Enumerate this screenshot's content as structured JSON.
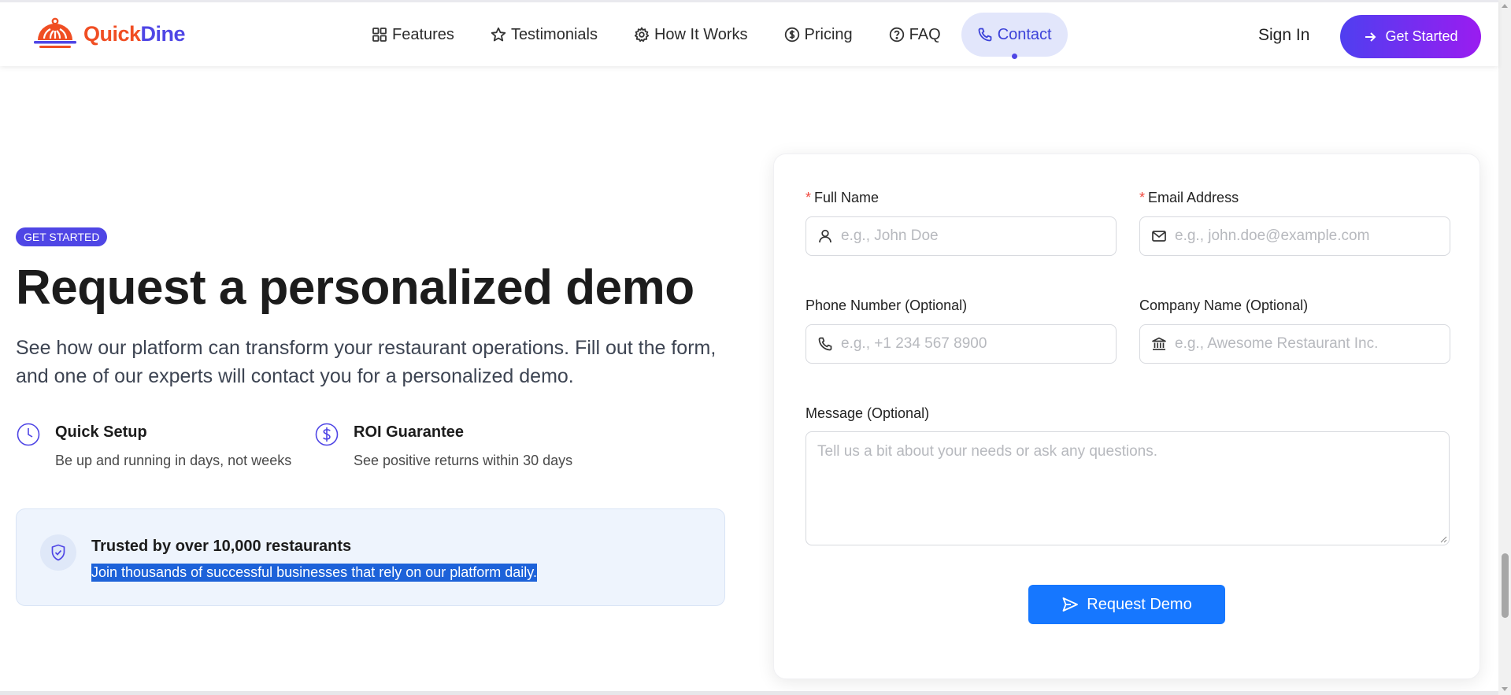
{
  "brand": {
    "name_part1": "Quick",
    "name_part2": "Dine"
  },
  "nav": {
    "items": [
      {
        "label": "Features",
        "icon": "grid-icon"
      },
      {
        "label": "Testimonials",
        "icon": "star-icon"
      },
      {
        "label": "How It Works",
        "icon": "gear-icon"
      },
      {
        "label": "Pricing",
        "icon": "dollar-circle-icon"
      },
      {
        "label": "FAQ",
        "icon": "question-circle-icon"
      },
      {
        "label": "Contact",
        "icon": "phone-icon",
        "active": true
      }
    ],
    "sign_in": "Sign In",
    "get_started": "Get Started"
  },
  "hero": {
    "badge": "GET STARTED",
    "title": "Request a personalized demo",
    "description": "See how our platform can transform your restaurant operations. Fill out the form, and one of our experts will contact you for a personalized demo.",
    "features": [
      {
        "title": "Quick Setup",
        "desc": "Be up and running in days, not weeks",
        "icon": "clock-icon"
      },
      {
        "title": "ROI Guarantee",
        "desc": "See positive returns within 30 days",
        "icon": "dollar-circle-icon"
      }
    ],
    "trust": {
      "title": "Trusted by over 10,000 restaurants",
      "desc": "Join thousands of successful businesses that rely on our platform daily."
    }
  },
  "form": {
    "full_name": {
      "label": "Full Name",
      "placeholder": "e.g., John Doe",
      "required": true
    },
    "email": {
      "label": "Email Address",
      "placeholder": "e.g., john.doe@example.com",
      "required": true
    },
    "phone": {
      "label": "Phone Number (Optional)",
      "placeholder": "e.g., +1 234 567 8900"
    },
    "company": {
      "label": "Company Name (Optional)",
      "placeholder": "e.g., Awesome Restaurant Inc."
    },
    "message": {
      "label": "Message (Optional)",
      "placeholder": "Tell us a bit about your needs or ask any questions."
    },
    "required_mark": "*",
    "submit": "Request Demo"
  },
  "colors": {
    "brand_orange": "#f04e23",
    "brand_indigo": "#4f46e5",
    "submit_blue": "#1677ff",
    "gradient_start": "#4f3ff0",
    "gradient_end": "#9a1cf0"
  }
}
